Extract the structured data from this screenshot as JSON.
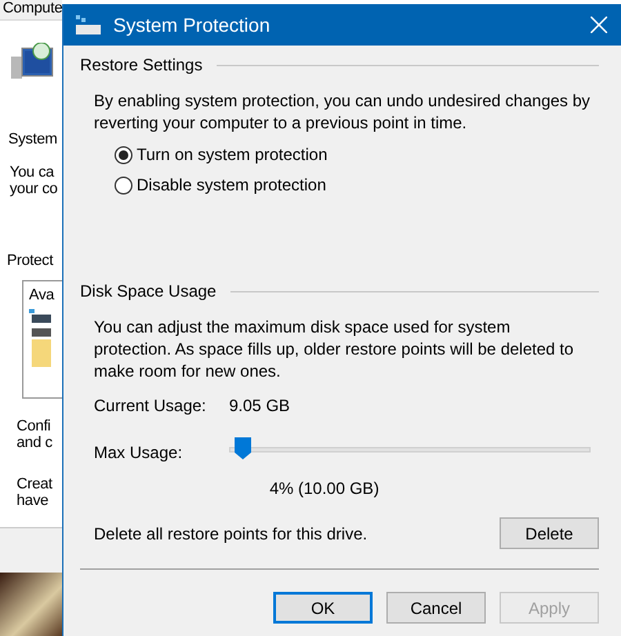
{
  "background_window": {
    "tab": "Compute",
    "heading": "System",
    "description_lines": [
      "You ca",
      "your co"
    ],
    "section_label": "Protect",
    "drive_list_header": "Ava",
    "config_lines": [
      "Confi",
      "and c"
    ],
    "create_lines": [
      "Creat",
      "have"
    ]
  },
  "dialog": {
    "title": "System Protection",
    "restore_settings": {
      "heading": "Restore Settings",
      "description": "By enabling system protection, you can undo undesired changes by reverting your computer to a previous point in time.",
      "options": [
        {
          "label": "Turn on system protection",
          "selected": true
        },
        {
          "label": "Disable system protection",
          "selected": false
        }
      ]
    },
    "disk_space_usage": {
      "heading": "Disk Space Usage",
      "description": "You can adjust the maximum disk space used for system protection. As space fills up, older restore points will be deleted to make room for new ones.",
      "current_usage_label": "Current Usage:",
      "current_usage_value": "9.05 GB",
      "max_usage_label": "Max Usage:",
      "max_usage": {
        "level": 0.04
      },
      "max_usage_reading": "4% (10.00 GB)",
      "delete_text": "Delete all restore points for this drive.",
      "delete_button": "Delete"
    },
    "buttons": [
      {
        "label": "OK",
        "focused": true,
        "disabled": false
      },
      {
        "label": "Cancel",
        "focused": false,
        "disabled": false
      },
      {
        "label": "Apply",
        "focused": false,
        "disabled": true
      }
    ]
  }
}
